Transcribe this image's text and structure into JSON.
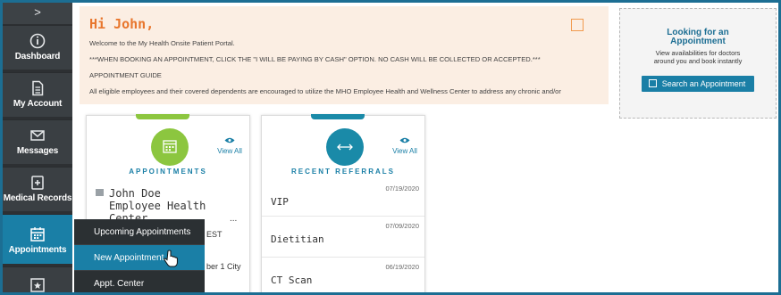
{
  "sidebar": {
    "collapse_label": ">",
    "items": [
      {
        "label": "Dashboard",
        "icon": "info-circle-icon"
      },
      {
        "label": "My Account",
        "icon": "document-icon"
      },
      {
        "label": "Messages",
        "icon": "envelope-icon"
      },
      {
        "label": "Medical Records",
        "icon": "medical-record-icon"
      },
      {
        "label": "Appointments",
        "icon": "calendar-icon"
      }
    ]
  },
  "flyout": {
    "items": [
      "Upcoming Appointments",
      "New Appointment",
      "Appt. Center"
    ]
  },
  "welcome": {
    "greeting": "Hi John,",
    "line1": "Welcome to the My Health Onsite Patient Portal.",
    "line2": "***WHEN BOOKING AN APPOINTMENT, CLICK THE \"I WILL BE PAYING BY CASH\" OPTION. NO CASH WILL BE COLLECTED OR ACCEPTED.***",
    "line3": "APPOINTMENT GUIDE",
    "line4": "All eligible employees and their covered dependents are encouraged to utilize the MHO Employee Health and Wellness Center to address any chronic and/or"
  },
  "promo": {
    "title_line1": "Looking for an",
    "title_line2": "Appointment",
    "sub_line1": "View availabilities for doctors",
    "sub_line2": "around you and book instantly",
    "button": "Search an Appointment"
  },
  "appointments_card": {
    "view_all": "View All",
    "title": "APPOINTMENTS",
    "provider_line1": "John Doe",
    "provider_line2": "Employee Health Center",
    "ellipsis": "...",
    "peek1": "EST",
    "peek2": "ber 1 City"
  },
  "referrals_card": {
    "view_all": "View All",
    "title": "RECENT REFERRALS",
    "items": [
      {
        "date": "07/19/2020",
        "name": "VIP"
      },
      {
        "date": "07/09/2020",
        "name": "Dietitian"
      },
      {
        "date": "06/19/2020",
        "name": "CT Scan"
      }
    ]
  },
  "colors": {
    "accent": "#1a7fa6",
    "greeting": "#e8762d",
    "sidebar": "#3a3f43",
    "appointments_circle": "#8cc63f",
    "referrals_circle": "#1a8aa8"
  }
}
